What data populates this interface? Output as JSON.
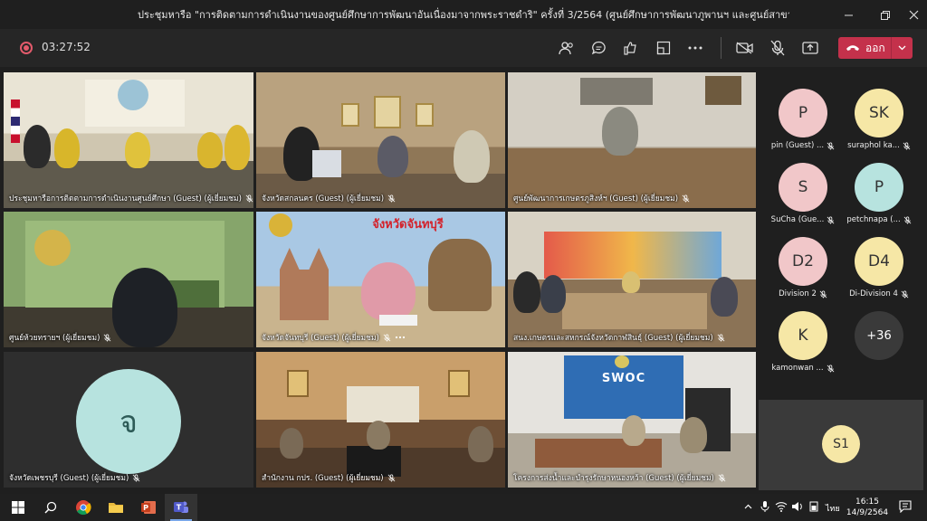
{
  "window": {
    "title": "ประชุมหารือ \"การติดตามการดำเนินงานของศูนย์ศึกษาการพัฒนาอันเนื่องมาจากพระราชดำริ\" ครั้งที่ 3/2564 (ศูนย์ศึกษาการพัฒนาภูพานฯ และศูนย์สาขา)",
    "minimize_icon": "minimize-icon",
    "maximize_icon": "restore-icon",
    "close_icon": "close-icon"
  },
  "toolbar": {
    "recording_icon": "record-icon",
    "timer": "03:27:52",
    "leave_label": "ออก",
    "colors": {
      "leave": "#c4314b",
      "active_border": "#8b8cc7"
    }
  },
  "tiles": [
    {
      "label": "ประชุมหารือการติดตามการดำเนินงานศูนย์ศึกษา (Guest) (ผู้เยี่ยมชม)"
    },
    {
      "label": "จังหวัดสกลนคร (Guest) (ผู้เยี่ยมชม)"
    },
    {
      "label": "ศูนย์พัฒนาการเกษตรภูสิงห์ฯ (Guest) (ผู้เยี่ยมชม)"
    },
    {
      "label": "ศูนย์ห้วยทรายฯ (ผู้เยี่ยมชม)"
    },
    {
      "label": "จังหวัดจันทบุรี (Guest) (ผู้เยี่ยมชม)",
      "banner": "จังหวัดจันทบุรี"
    },
    {
      "label": "สนง.เกษตรและสหกรณ์จังหวัดกาฬสินธุ์ (Guest) (ผู้เยี่ยมชม)"
    },
    {
      "label": "จังหวัดเพชรบุรี (Guest) (ผู้เยี่ยมชม)",
      "avatar": "จ"
    },
    {
      "label": "สำนักงาน กปร. (Guest) (ผู้เยี่ยมชม)"
    },
    {
      "label": "โครงการส่งน้ำและบำรุงรักษาหนองหว้า (Guest) (ผู้เยี่ยมชม)",
      "sign": "SWOC"
    }
  ],
  "roster": [
    {
      "initials": "P",
      "name": "pin (Guest) ...",
      "color": "#f1c7c9"
    },
    {
      "initials": "SK",
      "name": "suraphol ka...",
      "color": "#f6e7a6"
    },
    {
      "initials": "S",
      "name": "SuCha (Gue...",
      "color": "#f1c7c9"
    },
    {
      "initials": "P",
      "name": "petchnapa (...",
      "color": "#b7e3df"
    },
    {
      "initials": "D2",
      "name": "Division 2",
      "color": "#f1c7c9"
    },
    {
      "initials": "D4",
      "name": "Di-Division 4",
      "color": "#f6e7a6"
    },
    {
      "initials": "K",
      "name": "kamonwan ...",
      "color": "#f6e7a6"
    },
    {
      "initials": "+36",
      "name": "",
      "color": "#3a3a3a"
    }
  ],
  "self": {
    "initials": "S1"
  },
  "taskbar": {
    "time": "16:15",
    "date": "14/9/2564",
    "language": "ไทย"
  }
}
